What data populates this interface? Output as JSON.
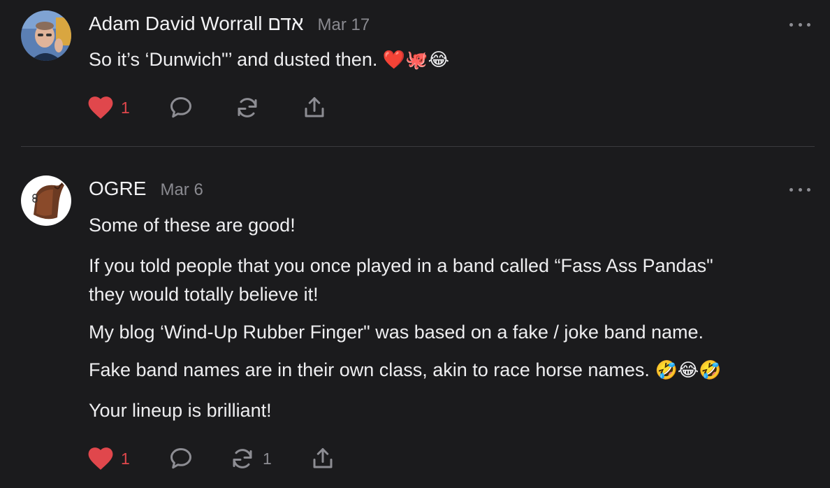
{
  "comments": [
    {
      "author": "Adam David Worrall אדם",
      "date": "Mar 17",
      "paragraphs": [
        {
          "text": "So it’s ‘Dunwich\"’ and dusted then.",
          "emoji": "❤️🐙😂"
        }
      ],
      "likes": "1",
      "restacks": ""
    },
    {
      "author": "OGRE",
      "date": "Mar 6",
      "paragraphs": [
        {
          "text": "Some of these are good!",
          "emoji": ""
        },
        {
          "text": "If you told people that you once played in a band called “Fass Ass Pandas\"",
          "emoji": ""
        },
        {
          "text": "they would totally believe it!",
          "emoji": ""
        },
        {
          "text": "My blog ‘Wind-Up Rubber Finger\" was based on a fake / joke band name.",
          "emoji": ""
        },
        {
          "text": "Fake band names are in their own class, akin to race horse names.",
          "emoji": "🤣😂🤣"
        },
        {
          "text": "Your lineup is brilliant!",
          "emoji": ""
        }
      ],
      "likes": "1",
      "restacks": "1"
    }
  ],
  "colors": {
    "background": "#1b1b1d",
    "heart": "#e0474c",
    "icon": "#8d8d93",
    "divider": "#3a3a3e"
  },
  "icons": [
    "heart-icon",
    "comment-icon",
    "restack-icon",
    "share-icon",
    "more-icon"
  ]
}
